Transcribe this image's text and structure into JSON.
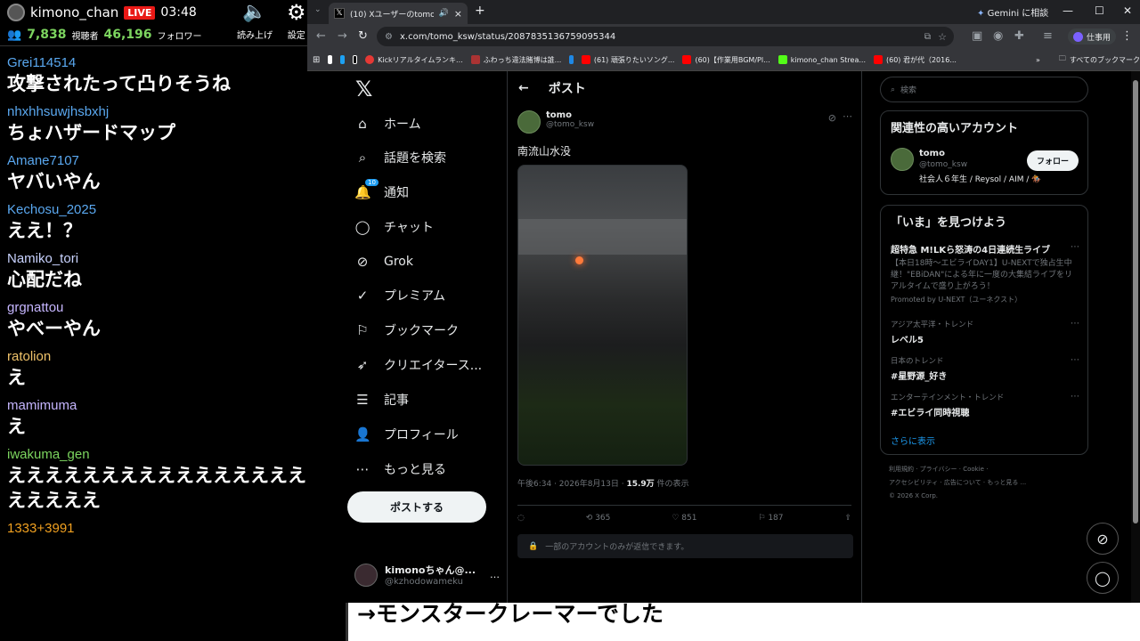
{
  "stream": {
    "channel": "kimono_chan",
    "live_badge": "LIVE",
    "time": "03:48",
    "viewers": "7,838",
    "viewers_label": "視聴者",
    "followers": "46,196",
    "followers_label": "フォロワー",
    "read_aloud_label": "読み上げ",
    "settings_label": "設定"
  },
  "chat": [
    {
      "user": "Grei114514",
      "color": "#5aa8f0",
      "text": "攻撃されたって凸りそうね"
    },
    {
      "user": "nhxhhsuwjhsbxhj",
      "color": "#5aa8f0",
      "text": "ちょハザードマップ"
    },
    {
      "user": "Amane7107",
      "color": "#5aa8f0",
      "text": "ヤバいやん"
    },
    {
      "user": "Kechosu_2025",
      "color": "#5aa8f0",
      "text": "ええ！？"
    },
    {
      "user": "Namiko_tori",
      "color": "#c9d3ff",
      "text": "心配だね"
    },
    {
      "user": "grgnattou",
      "color": "#c6b6ff",
      "text": "やべーやん"
    },
    {
      "user": "ratolion",
      "color": "#f0c36a",
      "text": "え"
    },
    {
      "user": "mamimuma",
      "color": "#c6b6ff",
      "text": "え"
    },
    {
      "user": "iwakuma_gen",
      "color": "#7cd55f",
      "text": "ええええええええええええええええええええええ"
    },
    {
      "user": "1333+3991",
      "color": "#f0a020",
      "text": ""
    }
  ],
  "browser": {
    "tab_title": "(10) Xユーザーのtomoさん:「南",
    "gemini": "Gemini に相談",
    "url": "x.com/tomo_ksw/status/2087835136759095344",
    "profile": "仕事用",
    "bookmarks": [
      "Kickリアルタイムランキ...",
      "ふわっち違法賭博は誰...",
      "(61) 頑張りたいソング...",
      "(60)【作業用BGM/Pl...",
      "kimono_chan Strea...",
      "(60) 君が代（2016..."
    ],
    "all_bookmarks": "すべてのブックマーク"
  },
  "nav": {
    "home": "ホーム",
    "explore": "話題を検索",
    "notifications": "通知",
    "notif_count": "10",
    "chat": "チャット",
    "grok": "Grok",
    "premium": "プレミアム",
    "bookmarks": "ブックマーク",
    "creator": "クリエイタース...",
    "articles": "記事",
    "profile": "プロフィール",
    "more": "もっと見る",
    "post_button": "ポストする",
    "account_name": "kimonoちゃん@...",
    "account_handle": "@kzhodowameku"
  },
  "post": {
    "header": "ポスト",
    "author": "tomo",
    "handle": "@tomo_ksw",
    "text": "南流山水没",
    "time": "午後6:34 · 2026年8月13日 · ",
    "views": "15.9万",
    "views_label": " 件の表示",
    "retweets": "365",
    "likes": "851",
    "bookmarks": "187",
    "reply_notice": "一部のアカウントのみが返信できます。"
  },
  "sidebar": {
    "search_placeholder": "検索",
    "relevant_title": "関連性の高いアカウント",
    "rel_name": "tomo",
    "rel_handle": "@tomo_ksw",
    "follow": "フォロー",
    "rel_bio": "社会人６年生 / Reysol / AIM / 🏇",
    "trends_title": "「いま」を見つけよう",
    "promo_title": "超特急 M!LKら怒涛の4日連続生ライブ",
    "promo_text": "【本日18時〜エビライDAY1】U-NEXTで独占生中継！\"EBiDAN\"による年に一度の大集結ライブをリアルタイムで盛り上がろう！",
    "promo_by": "Promoted by U-NEXT（ユーネクスト）",
    "trends": [
      {
        "sub": "アジア太平洋・トレンド",
        "main": "レベル5"
      },
      {
        "sub": "日本のトレンド",
        "main": "#星野源_好き"
      },
      {
        "sub": "エンターテインメント・トレンド",
        "main": "#エビライ同時視聴"
      }
    ],
    "show_more": "さらに表示",
    "footer1": "利用規約 · プライバシー · Cookie ·",
    "footer2": "アクセシビリティ · 広告について · もっと見る ...",
    "footer3": "© 2026 X Corp."
  },
  "caption": "→モンスタークレーマーでした"
}
